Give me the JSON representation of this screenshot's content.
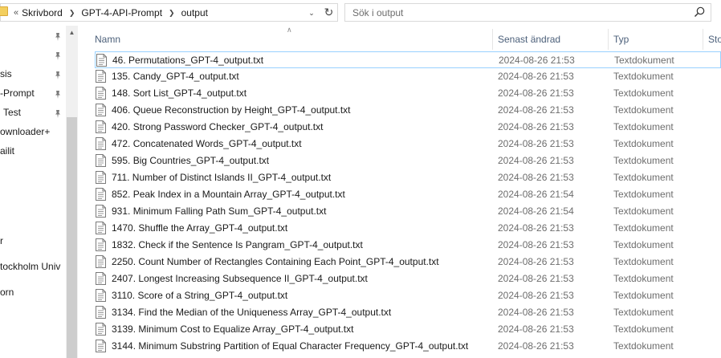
{
  "address": {
    "overflow_marker": "«",
    "crumbs": [
      "Skrivbord",
      "GPT-4-API-Prompt",
      "output"
    ],
    "dropdown_glyph": "⌄",
    "refresh_glyph": "↻"
  },
  "search": {
    "placeholder": "Sök i output"
  },
  "nav": {
    "items": [
      {
        "label": "",
        "pinned": true
      },
      {
        "label": "",
        "pinned": true
      },
      {
        "label": "sis",
        "pinned": true
      },
      {
        "label": "-Prompt",
        "pinned": true
      },
      {
        "label": "Test",
        "pinned": true
      },
      {
        "label": "ownloader+",
        "pinned": false
      },
      {
        "label": "ailit",
        "pinned": false
      },
      {
        "label": "",
        "pinned": false
      },
      {
        "label": "",
        "pinned": false
      },
      {
        "label": "",
        "pinned": false
      },
      {
        "label": "",
        "pinned": false
      },
      {
        "label": "r",
        "pinned": false
      },
      {
        "label": "tockholm Univ",
        "pinned": false
      },
      {
        "label": "",
        "pinned": false
      },
      {
        "label": "orn",
        "pinned": false
      }
    ],
    "pin_glyph": "📌"
  },
  "columns": {
    "name": "Namn",
    "modified": "Senast ändrad",
    "type": "Typ",
    "size": "Sto"
  },
  "files": [
    {
      "name": "46. Permutations_GPT-4_output.txt",
      "modified": "2024-08-26 21:53",
      "type": "Textdokument"
    },
    {
      "name": "135. Candy_GPT-4_output.txt",
      "modified": "2024-08-26 21:53",
      "type": "Textdokument"
    },
    {
      "name": "148. Sort List_GPT-4_output.txt",
      "modified": "2024-08-26 21:53",
      "type": "Textdokument"
    },
    {
      "name": "406. Queue Reconstruction by Height_GPT-4_output.txt",
      "modified": "2024-08-26 21:53",
      "type": "Textdokument"
    },
    {
      "name": "420. Strong Password Checker_GPT-4_output.txt",
      "modified": "2024-08-26 21:53",
      "type": "Textdokument"
    },
    {
      "name": "472. Concatenated Words_GPT-4_output.txt",
      "modified": "2024-08-26 21:53",
      "type": "Textdokument"
    },
    {
      "name": "595. Big Countries_GPT-4_output.txt",
      "modified": "2024-08-26 21:53",
      "type": "Textdokument"
    },
    {
      "name": "711. Number of Distinct Islands II_GPT-4_output.txt",
      "modified": "2024-08-26 21:53",
      "type": "Textdokument"
    },
    {
      "name": "852. Peak Index in a Mountain Array_GPT-4_output.txt",
      "modified": "2024-08-26 21:54",
      "type": "Textdokument"
    },
    {
      "name": "931. Minimum Falling Path Sum_GPT-4_output.txt",
      "modified": "2024-08-26 21:54",
      "type": "Textdokument"
    },
    {
      "name": "1470. Shuffle the Array_GPT-4_output.txt",
      "modified": "2024-08-26 21:53",
      "type": "Textdokument"
    },
    {
      "name": "1832. Check if the Sentence Is Pangram_GPT-4_output.txt",
      "modified": "2024-08-26 21:53",
      "type": "Textdokument"
    },
    {
      "name": "2250. Count Number of Rectangles Containing Each Point_GPT-4_output.txt",
      "modified": "2024-08-26 21:53",
      "type": "Textdokument"
    },
    {
      "name": "2407. Longest Increasing Subsequence II_GPT-4_output.txt",
      "modified": "2024-08-26 21:53",
      "type": "Textdokument"
    },
    {
      "name": "3110. Score of a String_GPT-4_output.txt",
      "modified": "2024-08-26 21:53",
      "type": "Textdokument"
    },
    {
      "name": "3134. Find the Median of the Uniqueness Array_GPT-4_output.txt",
      "modified": "2024-08-26 21:53",
      "type": "Textdokument"
    },
    {
      "name": "3139. Minimum Cost to Equalize Array_GPT-4_output.txt",
      "modified": "2024-08-26 21:53",
      "type": "Textdokument"
    },
    {
      "name": "3144. Minimum Substring Partition of Equal Character Frequency_GPT-4_output.txt",
      "modified": "2024-08-26 21:53",
      "type": "Textdokument"
    }
  ],
  "colors": {
    "header_text": "#4c607a",
    "focus_border": "#99d1ff",
    "secondary_text": "#6d6d6d"
  }
}
